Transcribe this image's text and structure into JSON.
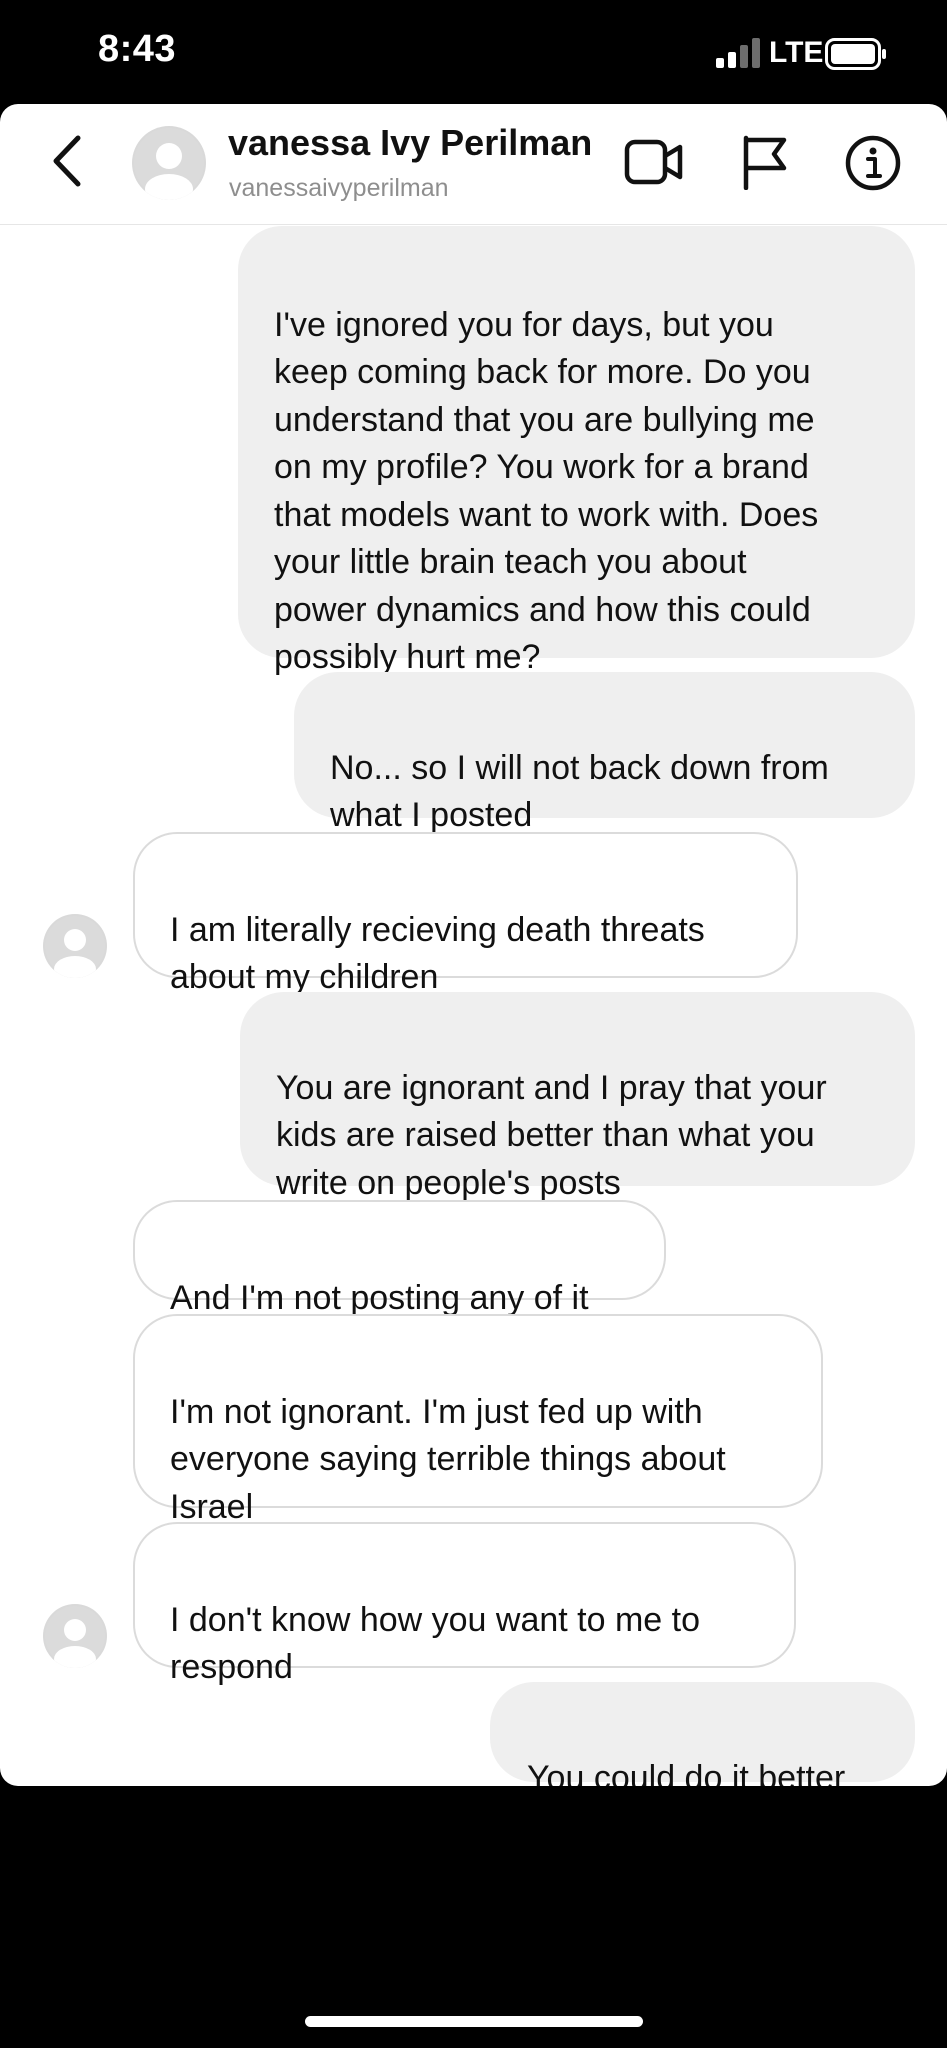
{
  "status_bar": {
    "time": "8:43",
    "network": "LTE"
  },
  "header": {
    "back_icon": "chevron-left-icon",
    "display_name": "vanessa Ivy Perilman",
    "username": "vanessaivyperilman",
    "actions": [
      "video-call-icon",
      "flag-icon",
      "info-icon"
    ]
  },
  "messages": [
    {
      "direction": "sent",
      "text": "I've ignored you for days, but you\nkeep coming back for more. Do you\nunderstand that you are bullying me\non my profile? You work for a brand\nthat models want to work with. Does\nyour little brain teach you about\npower dynamics and how this could\npossibly hurt me?"
    },
    {
      "direction": "sent",
      "text": "No... so I will not back down from\nwhat I posted"
    },
    {
      "direction": "received",
      "text": "I am literally recieving death threats\nabout my children"
    },
    {
      "direction": "sent",
      "text": "You are ignorant and I pray that your\nkids are raised better than what you\nwrite on people's posts"
    },
    {
      "direction": "received",
      "text": "And I'm not posting any of it"
    },
    {
      "direction": "received",
      "text": "I'm not ignorant. I'm just fed up with\neveryone saying terrible things about\nIsrael"
    },
    {
      "direction": "received",
      "text": "I don't know how you want to me to\nrespond"
    },
    {
      "direction": "sent",
      "text": "You could do it better"
    }
  ],
  "colors": {
    "sent_bubble": "#efefef",
    "received_border": "#dbdbdb",
    "username": "#8e8e8e",
    "background": "#000000"
  }
}
